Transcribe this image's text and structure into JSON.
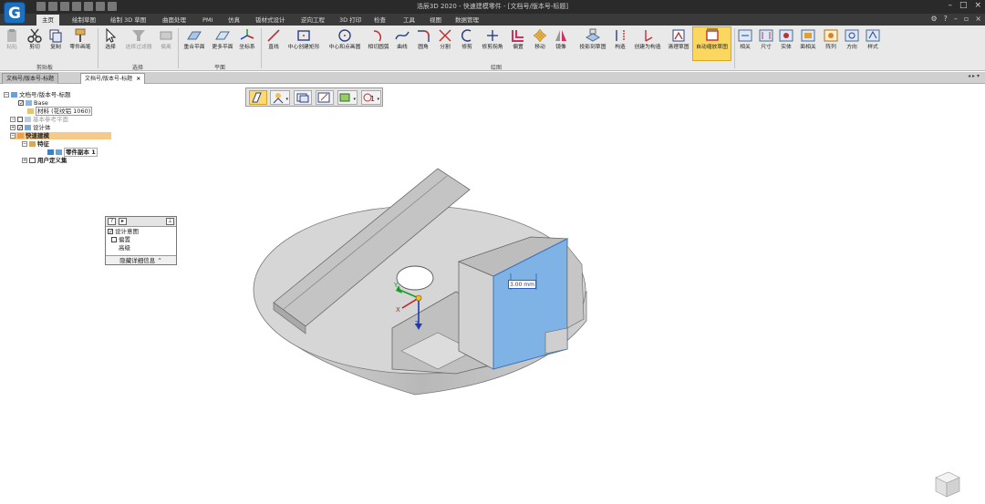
{
  "title": "浩辰3D 2020 - 快速建模零件 - [文档号/版本号-标题]",
  "app_logo_letter": "G",
  "menu_tabs": [
    "主页",
    "绘制草图",
    "绘制 3D 草图",
    "曲面处理",
    "PMI",
    "仿真",
    "钣材式设计",
    "逆向工程",
    "3D 打印",
    "检查",
    "工具",
    "视图",
    "数据管理"
  ],
  "ribbon": {
    "clipboard": {
      "paste": "粘贴",
      "cut": "剪切",
      "copy": "复制",
      "part_painter": "零件画笔",
      "group": "剪贴板"
    },
    "select": {
      "select": "选择",
      "select_filter": "选择过滤器",
      "deselect": "偏离",
      "group": "选择"
    },
    "plane": {
      "coincident_plane": "重合平面",
      "more_planes": "更多平面",
      "coordinate_system": "坐标系",
      "group": "平面"
    },
    "draw": {
      "items": [
        "直线",
        "中心创建矩形",
        "中心和点画圆",
        "相切圆弧",
        "曲线",
        "圆角",
        "分割",
        "修剪",
        "修剪拐角",
        "偏置",
        "移动",
        "镜像",
        "投影到草图",
        "构造",
        "创建为构造",
        "清理草图"
      ],
      "group": "绘图"
    },
    "auto_dimension": "自动缩放草图",
    "relations": [
      "相关",
      "尺寸",
      "实体",
      "面相关",
      "阵列",
      "方向",
      "样式"
    ]
  },
  "doc_tabs": [
    {
      "label": "文档号/版本号-标题",
      "active": false
    },
    {
      "label": "文档号/版本号-标题",
      "active": true,
      "close": "×"
    }
  ],
  "tree": {
    "root": "文档号/版本号-标题",
    "base": "Base",
    "material": "材料 (花纹铝 1060)",
    "ref_planes": "基本参考平面",
    "design_body": "设计体",
    "quick_model": "快速建模",
    "feature": "特征",
    "part_copy": "零件副本 1",
    "user_sets": "用户定义集"
  },
  "design_panel": {
    "help": "?",
    "play": "▸",
    "pin": "⊥",
    "design_intent": "设计意图",
    "offset": "偏置",
    "advanced": "高级",
    "hide_details": "隐藏详细信息",
    "collapse": "⌃"
  },
  "dimension_value": "3.00 mm",
  "axes": {
    "x": "X",
    "y": "Y",
    "z": "Z"
  },
  "colors": {
    "selected_face": "#7fb2e5",
    "ribbon_highlight": "#fbd760",
    "titlebar": "#2a2a2a",
    "part_face": "#c8c8c8"
  },
  "icons": [
    "paste-icon",
    "scissors-icon",
    "copy-icon",
    "painter-icon",
    "cursor-icon",
    "filter-icon",
    "plane-icon",
    "axes-icon",
    "line-icon",
    "rectangle-icon",
    "circle-icon",
    "arc-icon",
    "curve-icon",
    "fillet-icon",
    "split-icon",
    "trim-icon",
    "offset-icon",
    "move-icon",
    "mirror-icon",
    "project-icon",
    "construct-icon",
    "clean-icon"
  ]
}
